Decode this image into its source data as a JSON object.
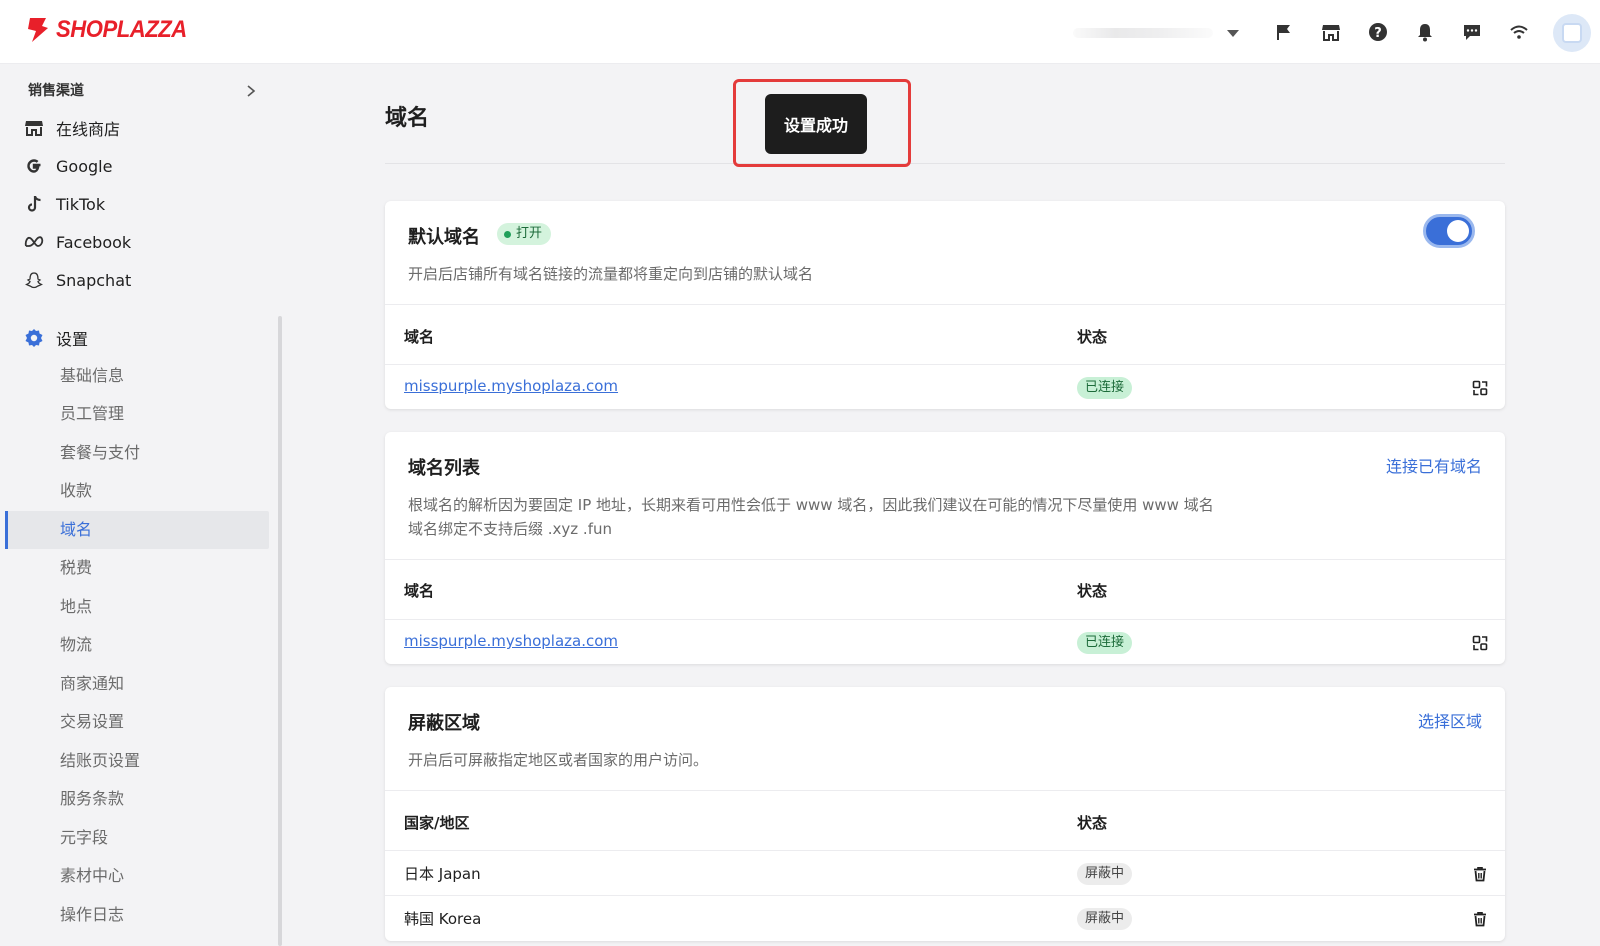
{
  "header": {
    "brand": "SHOPLAZZA",
    "icons": [
      "flag-icon",
      "store-icon",
      "help-icon",
      "bell-icon",
      "message-icon",
      "wifi-icon"
    ]
  },
  "sidebar": {
    "section_channels": "销售渠道",
    "channels": [
      {
        "label": "在线商店",
        "icon": "storefront-icon"
      },
      {
        "label": "Google",
        "icon": "google-icon"
      },
      {
        "label": "TikTok",
        "icon": "tiktok-icon"
      },
      {
        "label": "Facebook",
        "icon": "meta-icon"
      },
      {
        "label": "Snapchat",
        "icon": "snapchat-icon"
      }
    ],
    "settings_label": "设置",
    "settings_items": [
      "基础信息",
      "员工管理",
      "套餐与支付",
      "收款",
      "域名",
      "税费",
      "地点",
      "物流",
      "商家通知",
      "交易设置",
      "结账页设置",
      "服务条款",
      "元字段",
      "素材中心",
      "操作日志"
    ],
    "active_item": "域名"
  },
  "main": {
    "page_title": "域名",
    "toast": "设置成功",
    "default_domain": {
      "title": "默认域名",
      "badge": "打开",
      "toggle_on": true,
      "description": "开启后店铺所有域名链接的流量都将重定向到店铺的默认域名",
      "col_domain": "域名",
      "col_status": "状态",
      "rows": [
        {
          "domain": "misspurple.myshoplaza.com",
          "status": "已连接"
        }
      ]
    },
    "domain_list": {
      "title": "域名列表",
      "action": "连接已有域名",
      "description_1": "根域名的解析因为要固定 IP 地址，长期来看可用性会低于 www 域名，因此我们建议在可能的情况下尽量使用 www 域名",
      "description_2": "域名绑定不支持后缀 .xyz .fun",
      "col_domain": "域名",
      "col_status": "状态",
      "rows": [
        {
          "domain": "misspurple.myshoplaza.com",
          "status": "已连接"
        }
      ]
    },
    "blocked_regions": {
      "title": "屏蔽区域",
      "action": "选择区域",
      "description": "开启后可屏蔽指定地区或者国家的用户访问。",
      "col_region": "国家/地区",
      "col_status": "状态",
      "rows": [
        {
          "region": "日本 Japan",
          "status": "屏蔽中"
        },
        {
          "region": "韩国 Korea",
          "status": "屏蔽中"
        }
      ]
    }
  },
  "colors": {
    "brand_red": "#e8202a",
    "accent_blue": "#3a6fd8",
    "success_green": "#c8f0d6",
    "highlight_red": "#e43b3b"
  }
}
